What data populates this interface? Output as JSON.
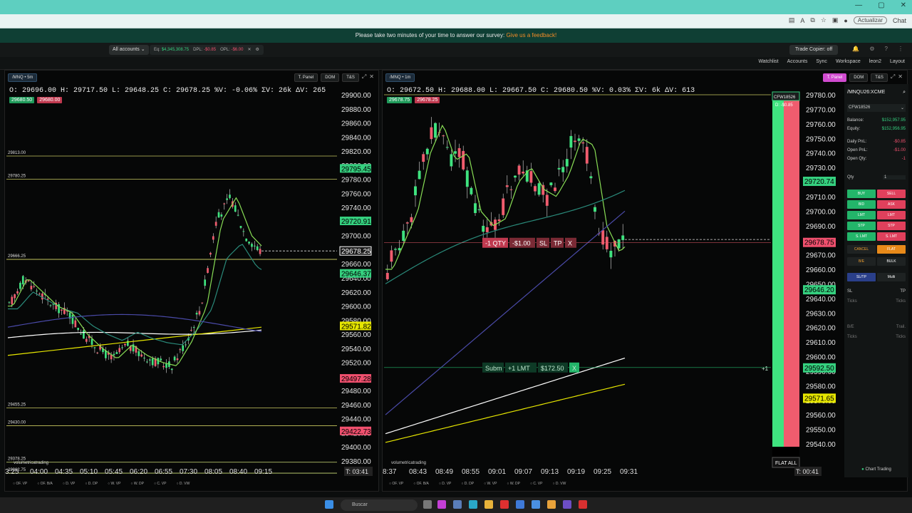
{
  "app": {
    "survey_text": "Please take two minutes of your time to answer our survey:",
    "survey_link": "Give us a feedback!",
    "update_label": "Actualizar",
    "chat_label": "Chat"
  },
  "account_bar": {
    "account_select": "All accounts",
    "eq_label": "Eq:",
    "eq_value": "$4,345,308.75",
    "dpl_label": "DPL:",
    "dpl_value": "-$0.85",
    "opl_label": "OPL:",
    "opl_value": "-$6.00",
    "trade_copier": "Trade Copier: off"
  },
  "nav": {
    "items": [
      "Watchlist",
      "Accounts",
      "Sync",
      "Workspace",
      "leon2",
      "Layout"
    ]
  },
  "left_chart": {
    "symbol_tab": "/MNQ • 5m",
    "buttons": [
      "T. Panel",
      "DOM",
      "T&S"
    ],
    "ohlc": "O: 29696.00  H: 29717.50  L: 29648.25  C: 29678.25  %V: -0.06%  ΣV: 26k  ΔV: 265",
    "bid": "29680.50",
    "ask": "29680.00",
    "price_ticks": [
      "29900.00",
      "29880.00",
      "29860.00",
      "29840.00",
      "29820.00",
      "29800.00",
      "29780.00",
      "29760.00",
      "29740.00",
      "29720.00",
      "29700.00",
      "29680.00",
      "29660.00",
      "29640.00",
      "29620.00",
      "29600.00",
      "29580.00",
      "29560.00",
      "29540.00",
      "29520.00",
      "29500.00",
      "29480.00",
      "29460.00",
      "29440.00",
      "29420.00",
      "29400.00",
      "29380.00"
    ],
    "level_labels": [
      "29813.00",
      "29780.25",
      "29666.25",
      "29455.25",
      "29430.00",
      "29378.25",
      "29362.75"
    ],
    "price_tags": [
      {
        "label": "29795.45",
        "color": "#35d07f"
      },
      {
        "label": "29720.91",
        "color": "#35d07f"
      },
      {
        "label": "29678.25",
        "color": "#ffffff"
      },
      {
        "label": "29646.37",
        "color": "#35d07f"
      },
      {
        "label": "29571.82",
        "color": "#e6e600"
      },
      {
        "label": "29497.28",
        "color": "#f0506e"
      },
      {
        "label": "29422.73",
        "color": "#f0506e"
      }
    ],
    "time_ticks": [
      "3:25",
      "04:00",
      "04:35",
      "05:10",
      "05:45",
      "06:20",
      "06:55",
      "07:30",
      "08:05",
      "08:40",
      "09:15"
    ],
    "timer": "T: 03:41",
    "studies": [
      "OF. VP",
      "OF. B/A",
      "D. VP",
      "D. DP",
      "W. VP",
      "W. DP",
      "C. VP",
      "D. VW"
    ],
    "brand": "volumetricatrading"
  },
  "right_chart": {
    "symbol_tab": "/MNQ • 1m",
    "buttons": [
      "T. Panel",
      "DOM",
      "T&S"
    ],
    "ohlc": "O: 29672.50  H: 29688.00  L: 29667.50  C: 29680.50  %V: 0.03%  ΣV: 6k  ΔV: 613",
    "bid": "29678.75",
    "ask": "29678.25",
    "price_ticks": [
      "29780.00",
      "29770.00",
      "29760.00",
      "29750.00",
      "29740.00",
      "29730.00",
      "29720.00",
      "29710.00",
      "29700.00",
      "29690.00",
      "29680.00",
      "29670.00",
      "29660.00",
      "29650.00",
      "29640.00",
      "29630.00",
      "29620.00",
      "29610.00",
      "29600.00",
      "29590.00",
      "29580.00",
      "29570.00",
      "29560.00",
      "29550.00",
      "29540.00"
    ],
    "price_tags": [
      {
        "label": "29720.74",
        "color": "#35d07f"
      },
      {
        "label": "29678.75",
        "color": "#f0506e"
      },
      {
        "label": "29646.20",
        "color": "#35d07f"
      },
      {
        "label": "29592.50",
        "color": "#35d07f"
      },
      {
        "label": "29571.65",
        "color": "#e6e600"
      }
    ],
    "position_chip": {
      "qty": "-1 QTY",
      "pnl": "-$1.00",
      "sl": "SL",
      "tp": "TP",
      "close": "X"
    },
    "order_chip": {
      "status": "Subm",
      "type": "+1 LMT",
      "price": "$172.50",
      "close": "X",
      "side": "+1"
    },
    "time_ticks": [
      "8:37",
      "08:43",
      "08:49",
      "08:55",
      "09:01",
      "09:07",
      "09:13",
      "09:19",
      "09:25",
      "09:31"
    ],
    "timer": "T: 00:41",
    "account_tag": "CFW18526",
    "dpl_tag": "D: -$0.85",
    "flat_all": "FLAT ALL",
    "studies": [
      "OF. VP",
      "OF. B/A",
      "D. VP",
      "D. DP",
      "W. VP",
      "W. DP",
      "C. VP",
      "D. VW"
    ],
    "brand": "volumetricatrading"
  },
  "trade_panel": {
    "symbol": "/MNQU26:XCME",
    "account": "CFW18526",
    "balance_label": "Balance:",
    "balance": "$152,957.95",
    "equity_label": "Equity:",
    "equity": "$152,956.95",
    "daily_pnl_label": "Daily PnL:",
    "daily_pnl": "-$0.85",
    "open_pnl_label": "Open PnL:",
    "open_pnl": "-$1.00",
    "open_qty_label": "Open Qty:",
    "open_qty": "-1",
    "qty_label": "Qty",
    "qty_value": "1",
    "buttons_left": [
      "BUY",
      "BID",
      "LMT",
      "STP",
      "S. LMT"
    ],
    "buttons_right": [
      "SELL",
      "ASK",
      "LMT",
      "STP",
      "S. LMT"
    ],
    "cancel": "CANCEL",
    "flat": "FLAT",
    "be": "B/E",
    "bulk": "BULK",
    "sltp": "SL/TP",
    "multi": "Multi",
    "sl": "SL",
    "tp": "TP",
    "ticks": "Ticks",
    "be_label": "B/E",
    "trail": "Trail.",
    "chart_trading": "Chart Trading"
  },
  "taskbar": {
    "search": "Buscar"
  }
}
